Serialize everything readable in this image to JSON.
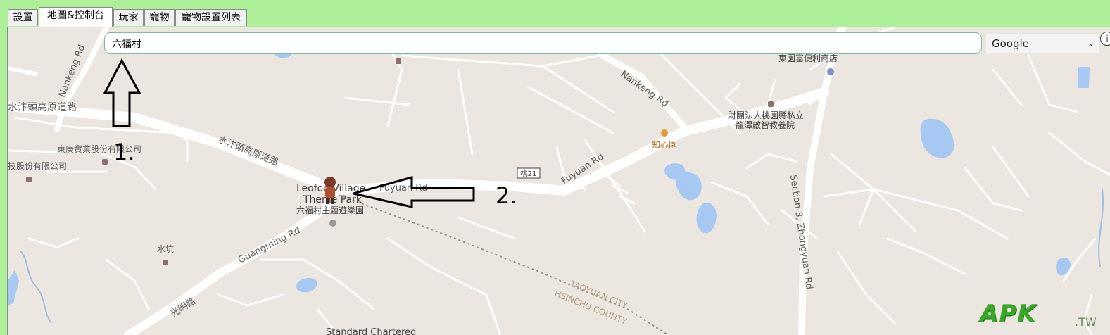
{
  "tabs": [
    {
      "label": "設置"
    },
    {
      "label": "地圖&控制台",
      "active": true
    },
    {
      "label": "玩家"
    },
    {
      "label": "寵物"
    },
    {
      "label": "寵物設置列表"
    }
  ],
  "search": {
    "value": "六福村"
  },
  "map_provider": {
    "selected": "Google"
  },
  "map": {
    "labels": {
      "nankeng_rd_left": "Nankeng Rd",
      "nankeng_rd_right": "Nankeng Rd",
      "plateau_road_left": "水汴頭高原道路",
      "plateau_road_diag": "水汴頭高原道路",
      "tung_ching": "東庚實業股份有限公司",
      "tech_co": "技股份有限公司",
      "leofoo_en_1": "Leofoo Village",
      "leofoo_en_2": "Theme Park",
      "leofoo_zh": "六福村主題遊樂園",
      "fuyuan_rd_a": "Fuyuan Rd",
      "fuyuan_rd_b": "Fuyuan Rd",
      "route_shield": "桃21",
      "zhixin": "知心園",
      "foundation_1": "財團法人桃園縣私立",
      "foundation_2": "龍潭啟智教養院",
      "store": "東園富便利商店",
      "section3": "Section 3, Zhongyuan Rd",
      "guangming_rd": "Guangming Rd",
      "guangming_zh": "光明路",
      "shuikeng": "水坑",
      "taoyuan_city": "TAOYUAN CITY",
      "hsinchu_county": "HSINCHU COUNTY",
      "standard_chartered": "Standard Chartered"
    },
    "colors": {
      "background": "#ebe6df",
      "road": "#ffffff",
      "water": "#a7c8f2",
      "poi": "#8c6e6e"
    }
  },
  "annotations": {
    "label_1": "1.",
    "label_2": "2."
  },
  "watermark": {
    "brand": "APK",
    "suffix": ".TW"
  }
}
